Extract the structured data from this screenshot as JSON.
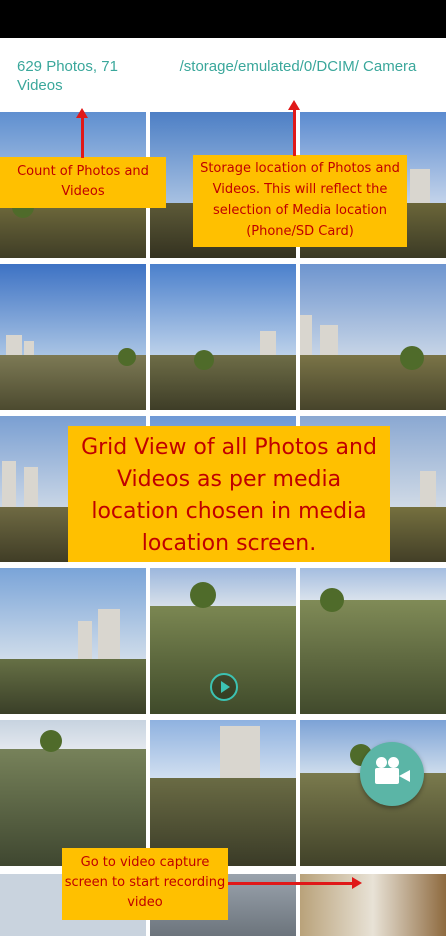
{
  "header": {
    "count_label": "629 Photos, 71 Videos",
    "path_label": "/storage/emulated/0/DCIM/ Camera"
  },
  "annotations": {
    "count_callout": "Count of Photos and Videos",
    "storage_callout": "Storage location of Photos and Videos. This will reflect the selection of Media location (Phone/SD Card)",
    "grid_callout": "Grid View of all Photos and Videos as per media location chosen in media location screen.",
    "record_callout": "Go to video capture screen to start recording video"
  },
  "icons": {
    "play": "play-icon",
    "fab": "video-camera-icon"
  },
  "colors": {
    "accent": "#3aa79b",
    "fab": "#5bb5a6",
    "callout_bg": "#ffc000",
    "callout_text": "#c00000",
    "arrow": "#e01818"
  }
}
